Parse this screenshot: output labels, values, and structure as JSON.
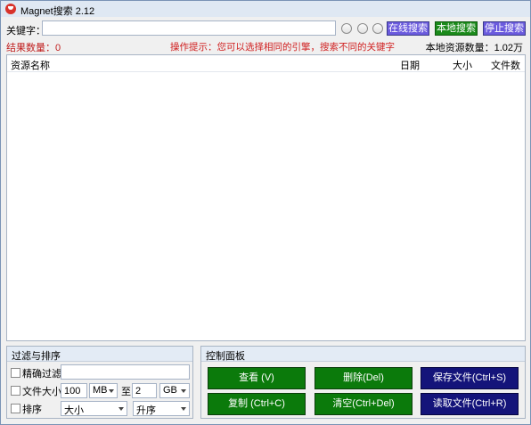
{
  "window": {
    "title": "Magnet搜索 2.12"
  },
  "search": {
    "keyword_label": "关键字：",
    "keyword_value": "",
    "online_button": "在线搜索",
    "local_button": "本地搜索",
    "stop_button": "停止搜索"
  },
  "status": {
    "result_count": "结果数量：0",
    "tip": "操作提示：您可以选择相同的引擎，搜索不同的关键字",
    "local_count": "本地资源数量：1.02万"
  },
  "list": {
    "columns": [
      "资源名称",
      "日期",
      "大小",
      "文件数"
    ]
  },
  "filter_panel": {
    "title": "过滤与排序",
    "exact_filter_label": "精确过滤",
    "exact_filter_value": "",
    "file_size_label": "文件大小",
    "size_min": "100",
    "size_min_unit": "MB",
    "to_label": "至",
    "size_max": "2",
    "size_max_unit": "GB",
    "sort_label": "排序",
    "sort_field": "大小",
    "sort_order": "升序"
  },
  "control_panel": {
    "title": "控制面板",
    "view_button": "查看 (V)",
    "delete_button": "删除(Del)",
    "save_button": "保存文件(Ctrl+S)",
    "copy_button": "复制 (Ctrl+C)",
    "clear_button": "清空(Ctrl+Del)",
    "read_button": "读取文件(Ctrl+R)"
  },
  "colors": {
    "primary_button": "#6b5bde",
    "local_button": "#1a8a1a",
    "control_green": "#0b7a0b",
    "control_navy": "#14147a",
    "tip_red": "#d02020"
  }
}
